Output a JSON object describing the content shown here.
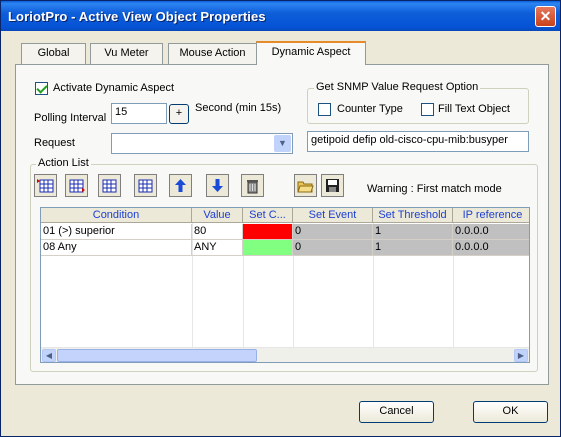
{
  "window": {
    "title": "LoriotPro - Active View Object Properties",
    "close_label": "✕"
  },
  "tabs": [
    {
      "label": "Global"
    },
    {
      "label": "Vu Meter"
    },
    {
      "label": "Mouse Action"
    },
    {
      "label": "Dynamic Aspect"
    }
  ],
  "dynamic": {
    "activate_label": "Activate Dynamic Aspect",
    "activate_checked": true,
    "polling_label": "Polling Interval",
    "polling_value": "15",
    "plus_label": "+",
    "polling_unit": "Second (min 15s)",
    "request_label": "Request",
    "request_value": "",
    "snmp_group_label": "Get SNMP Value Request Option",
    "counter_type_label": "Counter Type",
    "fill_text_label": "Fill Text Object",
    "request_text": "getipoid defip old-cisco-cpu-mib:busyper"
  },
  "action_list": {
    "label": "Action List",
    "warning": "Warning : First match mode",
    "columns": [
      "Condition",
      "Value",
      "Set C...",
      "Set Event",
      "Set Threshold",
      "IP reference"
    ],
    "rows": [
      {
        "condition": "01 (>) superior",
        "value": "80",
        "color": "#ff0000",
        "event": "0",
        "threshold": "1",
        "ip": "0.0.0.0"
      },
      {
        "condition": "08 Any",
        "value": "ANY",
        "color": "#80ff80",
        "event": "0",
        "threshold": "1",
        "ip": "0.0.0.0"
      }
    ]
  },
  "buttons": {
    "cancel": "Cancel",
    "ok": "OK"
  }
}
